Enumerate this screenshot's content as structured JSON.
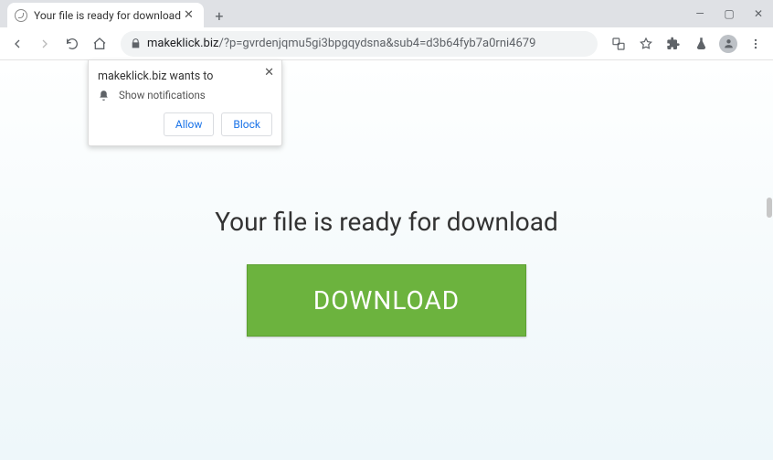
{
  "tab": {
    "title": "Your file is ready for download"
  },
  "window": {
    "min": "—",
    "max": "▢",
    "close": "✕",
    "newtab": "+"
  },
  "nav": {
    "back": "←",
    "forward": "→",
    "reload": "⟳",
    "home": "⌂"
  },
  "url": {
    "host": "makeklick.biz",
    "path": "/?p=gvrdenjqmu5gi3bpgqydsna&sub4=d3b64fyb7a0rni4679"
  },
  "toolbar_icons": {
    "translate": "⠿",
    "star": "☆",
    "ext": "✦",
    "puzzle": "▲",
    "menu": "⋮"
  },
  "notification": {
    "title": "makeklick.biz wants to",
    "message": "Show notifications",
    "allow": "Allow",
    "block": "Block",
    "close": "✕"
  },
  "page": {
    "headline": "Your file is ready for download",
    "download": "DOWNLOAD"
  }
}
